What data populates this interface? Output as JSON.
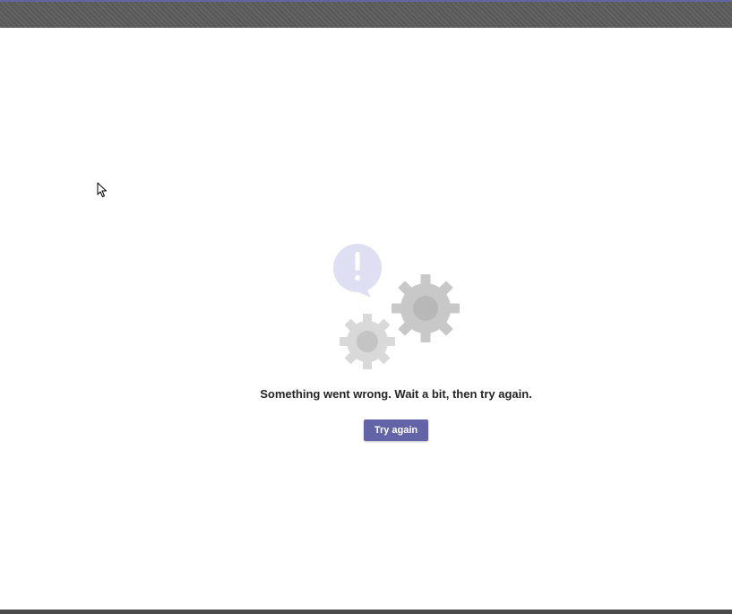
{
  "window": {
    "accent_color": "#6264a7",
    "titlebar_color": "#5c5c5c"
  },
  "error": {
    "message": "Something went wrong. Wait a bit, then try again.",
    "illustration_icon": "gears-with-alert-bubble-icon",
    "bubble_color": "#dedff3",
    "gear_color": "#c8c8c8"
  },
  "actions": {
    "retry_label": "Try again",
    "retry_color": "#6264a7"
  },
  "cursor": {
    "icon": "mouse-pointer-icon"
  }
}
